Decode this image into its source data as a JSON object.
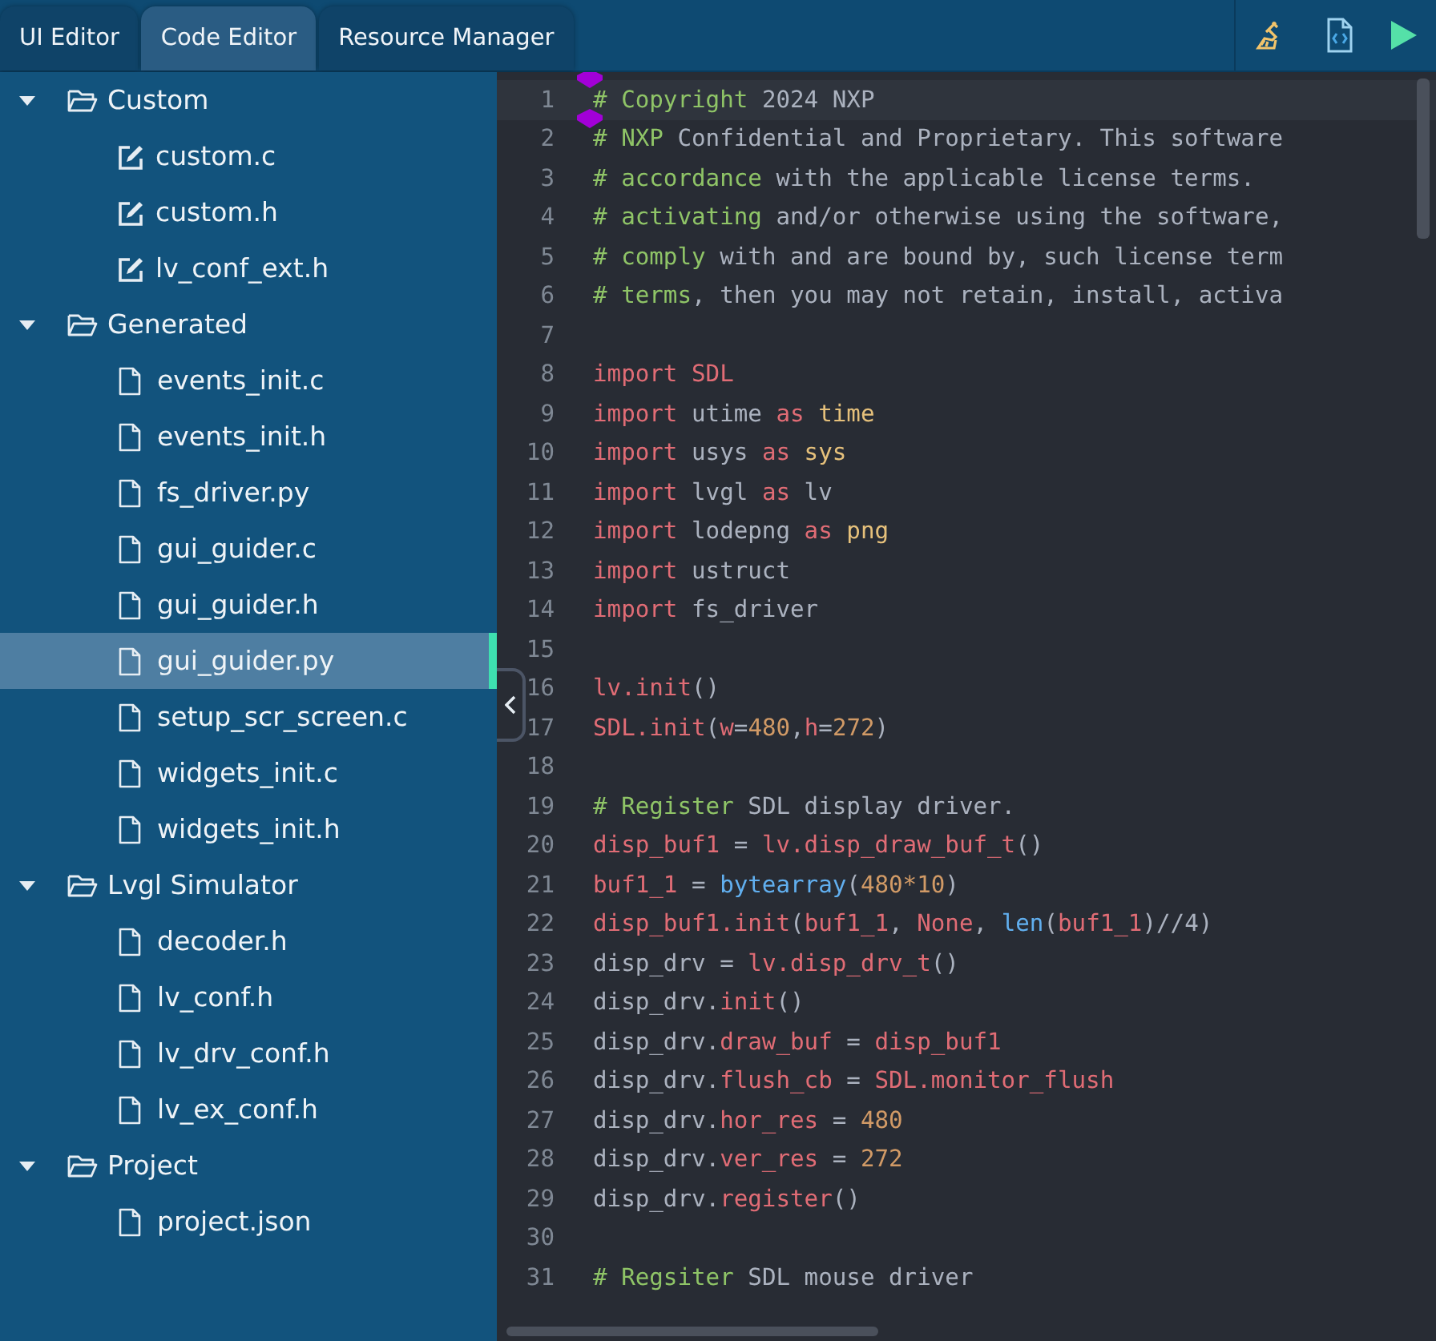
{
  "tabs": [
    {
      "label": "UI Editor",
      "selected": false
    },
    {
      "label": "Code Editor",
      "selected": true
    },
    {
      "label": "Resource Manager",
      "selected": false
    }
  ],
  "tree": [
    {
      "kind": "folder",
      "label": "Custom",
      "expanded": true,
      "children": [
        {
          "kind": "editable",
          "label": "custom.c",
          "selected": false
        },
        {
          "kind": "editable",
          "label": "custom.h",
          "selected": false
        },
        {
          "kind": "editable",
          "label": "lv_conf_ext.h",
          "selected": false
        }
      ]
    },
    {
      "kind": "folder",
      "label": "Generated",
      "expanded": true,
      "children": [
        {
          "kind": "file",
          "label": "events_init.c",
          "selected": false
        },
        {
          "kind": "file",
          "label": "events_init.h",
          "selected": false
        },
        {
          "kind": "file",
          "label": "fs_driver.py",
          "selected": false
        },
        {
          "kind": "file",
          "label": "gui_guider.c",
          "selected": false
        },
        {
          "kind": "file",
          "label": "gui_guider.h",
          "selected": false
        },
        {
          "kind": "file",
          "label": "gui_guider.py",
          "selected": true
        },
        {
          "kind": "file",
          "label": "setup_scr_screen.c",
          "selected": false
        },
        {
          "kind": "file",
          "label": "widgets_init.c",
          "selected": false
        },
        {
          "kind": "file",
          "label": "widgets_init.h",
          "selected": false
        }
      ]
    },
    {
      "kind": "folder",
      "label": "Lvgl Simulator",
      "expanded": true,
      "children": [
        {
          "kind": "file",
          "label": "decoder.h",
          "selected": false
        },
        {
          "kind": "file",
          "label": "lv_conf.h",
          "selected": false
        },
        {
          "kind": "file",
          "label": "lv_drv_conf.h",
          "selected": false
        },
        {
          "kind": "file",
          "label": "lv_ex_conf.h",
          "selected": false
        }
      ]
    },
    {
      "kind": "folder",
      "label": "Project",
      "expanded": true,
      "children": [
        {
          "kind": "file",
          "label": "project.json",
          "selected": false
        }
      ]
    }
  ],
  "editor": {
    "lines": [
      {
        "number": "1",
        "current": true,
        "marked": true,
        "tokens": [
          {
            "kind": "comment-word",
            "text": "# Copyright"
          },
          {
            "kind": "plain",
            "text": " 2024 NXP"
          }
        ]
      },
      {
        "number": "2",
        "current": false,
        "marked": true,
        "tokens": [
          {
            "kind": "comment-word",
            "text": "# NXP"
          },
          {
            "kind": "plain",
            "text": " Confidential and Proprietary. This software"
          }
        ]
      },
      {
        "number": "3",
        "current": false,
        "marked": false,
        "tokens": [
          {
            "kind": "comment-word",
            "text": "# accordance"
          },
          {
            "kind": "plain",
            "text": " with the applicable license terms."
          }
        ]
      },
      {
        "number": "4",
        "current": false,
        "marked": false,
        "tokens": [
          {
            "kind": "comment-word",
            "text": "# activating"
          },
          {
            "kind": "plain",
            "text": " and/or otherwise using the software,"
          }
        ]
      },
      {
        "number": "5",
        "current": false,
        "marked": false,
        "tokens": [
          {
            "kind": "comment-word",
            "text": "# comply"
          },
          {
            "kind": "plain",
            "text": " with and are bound by, such license term"
          }
        ]
      },
      {
        "number": "6",
        "current": false,
        "marked": false,
        "tokens": [
          {
            "kind": "comment-word",
            "text": "# terms"
          },
          {
            "kind": "plain",
            "text": ", then you may not retain, install, activa"
          }
        ]
      },
      {
        "number": "7",
        "current": false,
        "marked": false
      },
      {
        "number": "8",
        "current": false,
        "marked": false,
        "tokens": [
          {
            "kind": "keyword",
            "text": "import"
          },
          {
            "kind": "name",
            "text": " SDL"
          }
        ]
      },
      {
        "number": "9",
        "current": false,
        "marked": false,
        "tokens": [
          {
            "kind": "keyword",
            "text": "import"
          },
          {
            "kind": "plain",
            "text": " utime "
          },
          {
            "kind": "keyword",
            "text": "as"
          },
          {
            "kind": "alias",
            "text": " time"
          }
        ]
      },
      {
        "number": "10",
        "current": false,
        "marked": false,
        "tokens": [
          {
            "kind": "keyword",
            "text": "import"
          },
          {
            "kind": "plain",
            "text": " usys "
          },
          {
            "kind": "keyword",
            "text": "as"
          },
          {
            "kind": "alias",
            "text": " sys"
          }
        ]
      },
      {
        "number": "11",
        "current": false,
        "marked": false,
        "tokens": [
          {
            "kind": "keyword",
            "text": "import"
          },
          {
            "kind": "plain",
            "text": " lvgl "
          },
          {
            "kind": "keyword",
            "text": "as"
          },
          {
            "kind": "plain",
            "text": " lv"
          }
        ]
      },
      {
        "number": "12",
        "current": false,
        "marked": false,
        "tokens": [
          {
            "kind": "keyword",
            "text": "import"
          },
          {
            "kind": "plain",
            "text": " lodepng "
          },
          {
            "kind": "keyword",
            "text": "as"
          },
          {
            "kind": "alias",
            "text": " png"
          }
        ]
      },
      {
        "number": "13",
        "current": false,
        "marked": false,
        "tokens": [
          {
            "kind": "keyword",
            "text": "import"
          },
          {
            "kind": "plain",
            "text": " ustruct"
          }
        ]
      },
      {
        "number": "14",
        "current": false,
        "marked": false,
        "tokens": [
          {
            "kind": "keyword",
            "text": "import"
          },
          {
            "kind": "plain",
            "text": " fs_driver"
          }
        ]
      },
      {
        "number": "15",
        "current": false,
        "marked": false
      },
      {
        "number": "16",
        "current": false,
        "marked": false,
        "tokens": [
          {
            "kind": "name",
            "text": "lv.init"
          },
          {
            "kind": "plain",
            "text": "()"
          }
        ]
      },
      {
        "number": "17",
        "current": false,
        "marked": false,
        "tokens": [
          {
            "kind": "name",
            "text": "SDL.init"
          },
          {
            "kind": "plain",
            "text": "("
          },
          {
            "kind": "name",
            "text": "w"
          },
          {
            "kind": "plain",
            "text": "="
          },
          {
            "kind": "number",
            "text": "480"
          },
          {
            "kind": "plain",
            "text": ","
          },
          {
            "kind": "name",
            "text": "h"
          },
          {
            "kind": "plain",
            "text": "="
          },
          {
            "kind": "number",
            "text": "272"
          },
          {
            "kind": "plain",
            "text": ")"
          }
        ]
      },
      {
        "number": "18",
        "current": false,
        "marked": false
      },
      {
        "number": "19",
        "current": false,
        "marked": false,
        "tokens": [
          {
            "kind": "comment-word",
            "text": "# Register"
          },
          {
            "kind": "plain",
            "text": " SDL display driver."
          }
        ]
      },
      {
        "number": "20",
        "current": false,
        "marked": false,
        "tokens": [
          {
            "kind": "name",
            "text": "disp_buf1"
          },
          {
            "kind": "plain",
            "text": " = "
          },
          {
            "kind": "name",
            "text": "lv.disp_draw_buf_t"
          },
          {
            "kind": "plain",
            "text": "()"
          }
        ]
      },
      {
        "number": "21",
        "current": false,
        "marked": false,
        "tokens": [
          {
            "kind": "name",
            "text": "buf1_1"
          },
          {
            "kind": "plain",
            "text": " = "
          },
          {
            "kind": "function",
            "text": "bytearray"
          },
          {
            "kind": "plain",
            "text": "("
          },
          {
            "kind": "number",
            "text": "480*10"
          },
          {
            "kind": "plain",
            "text": ")"
          }
        ]
      },
      {
        "number": "22",
        "current": false,
        "marked": false,
        "tokens": [
          {
            "kind": "name",
            "text": "disp_buf1.init"
          },
          {
            "kind": "plain",
            "text": "("
          },
          {
            "kind": "name",
            "text": "buf1_1"
          },
          {
            "kind": "plain",
            "text": ", "
          },
          {
            "kind": "name",
            "text": "None"
          },
          {
            "kind": "plain",
            "text": ", "
          },
          {
            "kind": "function",
            "text": "len"
          },
          {
            "kind": "plain",
            "text": "("
          },
          {
            "kind": "name",
            "text": "buf1_1"
          },
          {
            "kind": "plain",
            "text": ")//4)"
          }
        ]
      },
      {
        "number": "23",
        "current": false,
        "marked": false,
        "tokens": [
          {
            "kind": "plain",
            "text": "disp_drv = "
          },
          {
            "kind": "name",
            "text": "lv.disp_drv_t"
          },
          {
            "kind": "plain",
            "text": "()"
          }
        ]
      },
      {
        "number": "24",
        "current": false,
        "marked": false,
        "tokens": [
          {
            "kind": "plain",
            "text": "disp_drv."
          },
          {
            "kind": "name",
            "text": "init"
          },
          {
            "kind": "plain",
            "text": "()"
          }
        ]
      },
      {
        "number": "25",
        "current": false,
        "marked": false,
        "tokens": [
          {
            "kind": "plain",
            "text": "disp_drv."
          },
          {
            "kind": "name",
            "text": "draw_buf"
          },
          {
            "kind": "plain",
            "text": " = "
          },
          {
            "kind": "name",
            "text": "disp_buf1"
          }
        ]
      },
      {
        "number": "26",
        "current": false,
        "marked": false,
        "tokens": [
          {
            "kind": "plain",
            "text": "disp_drv."
          },
          {
            "kind": "name",
            "text": "flush_cb"
          },
          {
            "kind": "plain",
            "text": " = "
          },
          {
            "kind": "name",
            "text": "SDL.monitor_flush"
          }
        ]
      },
      {
        "number": "27",
        "current": false,
        "marked": false,
        "tokens": [
          {
            "kind": "plain",
            "text": "disp_drv."
          },
          {
            "kind": "name",
            "text": "hor_res"
          },
          {
            "kind": "plain",
            "text": " = "
          },
          {
            "kind": "number",
            "text": "480"
          }
        ]
      },
      {
        "number": "28",
        "current": false,
        "marked": false,
        "tokens": [
          {
            "kind": "plain",
            "text": "disp_drv."
          },
          {
            "kind": "name",
            "text": "ver_res"
          },
          {
            "kind": "plain",
            "text": " = "
          },
          {
            "kind": "number",
            "text": "272"
          }
        ]
      },
      {
        "number": "29",
        "current": false,
        "marked": false,
        "tokens": [
          {
            "kind": "plain",
            "text": "disp_drv."
          },
          {
            "kind": "name",
            "text": "register"
          },
          {
            "kind": "plain",
            "text": "()"
          }
        ]
      },
      {
        "number": "30",
        "current": false,
        "marked": false
      },
      {
        "number": "31",
        "current": false,
        "marked": false,
        "tokens": [
          {
            "kind": "comment-word",
            "text": "# Regsiter"
          },
          {
            "kind": "plain",
            "text": " SDL mouse driver"
          }
        ]
      }
    ]
  }
}
